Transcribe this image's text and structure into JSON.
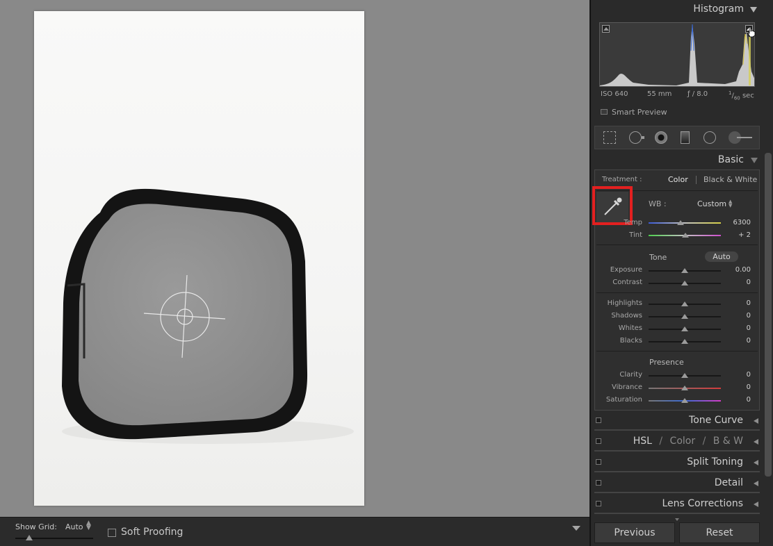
{
  "histogram": {
    "title": "Histogram",
    "iso": "ISO 640",
    "focal_length": "55 mm",
    "aperture": "ƒ / 8.0",
    "shutter_num": "1",
    "shutter_den": "60",
    "shutter_unit": "sec",
    "smart_preview": "Smart Preview"
  },
  "basic": {
    "title": "Basic",
    "treatment_label": "Treatment :",
    "treatment_color": "Color",
    "treatment_bw": "Black & White",
    "wb_label": "WB :",
    "wb_value": "Custom",
    "temp_label": "Temp",
    "temp_value": "6300",
    "tint_label": "Tint",
    "tint_value": "+ 2",
    "tone_label": "Tone",
    "auto_label": "Auto",
    "exposure_label": "Exposure",
    "exposure_value": "0.00",
    "contrast_label": "Contrast",
    "contrast_value": "0",
    "highlights_label": "Highlights",
    "highlights_value": "0",
    "shadows_label": "Shadows",
    "shadows_value": "0",
    "whites_label": "Whites",
    "whites_value": "0",
    "blacks_label": "Blacks",
    "blacks_value": "0",
    "presence_label": "Presence",
    "clarity_label": "Clarity",
    "clarity_value": "0",
    "vibrance_label": "Vibrance",
    "vibrance_value": "0",
    "saturation_label": "Saturation",
    "saturation_value": "0",
    "slider_levels": {
      "temp": 0.44,
      "tint": 0.51,
      "exposure": 0.5,
      "contrast": 0.5,
      "highlights": 0.5,
      "shadows": 0.5,
      "whites": 0.5,
      "blacks": 0.5,
      "clarity": 0.5,
      "vibrance": 0.5,
      "saturation": 0.5
    }
  },
  "panels": {
    "tone_curve": "Tone Curve",
    "hsl": "HSL",
    "hsl_sep": "/",
    "hsl_color": "Color",
    "hsl_bw": "B & W",
    "split_toning": "Split Toning",
    "detail": "Detail",
    "lens_corrections": "Lens Corrections"
  },
  "toolbar": {
    "show_grid_label": "Show Grid:",
    "show_grid_value": "Auto",
    "soft_proofing": "Soft Proofing"
  },
  "buttons": {
    "previous": "Previous",
    "reset": "Reset"
  },
  "colors": {
    "highlight": "#e32020",
    "panel_bg": "#2a2a2a",
    "canvas_bg": "#898989"
  }
}
